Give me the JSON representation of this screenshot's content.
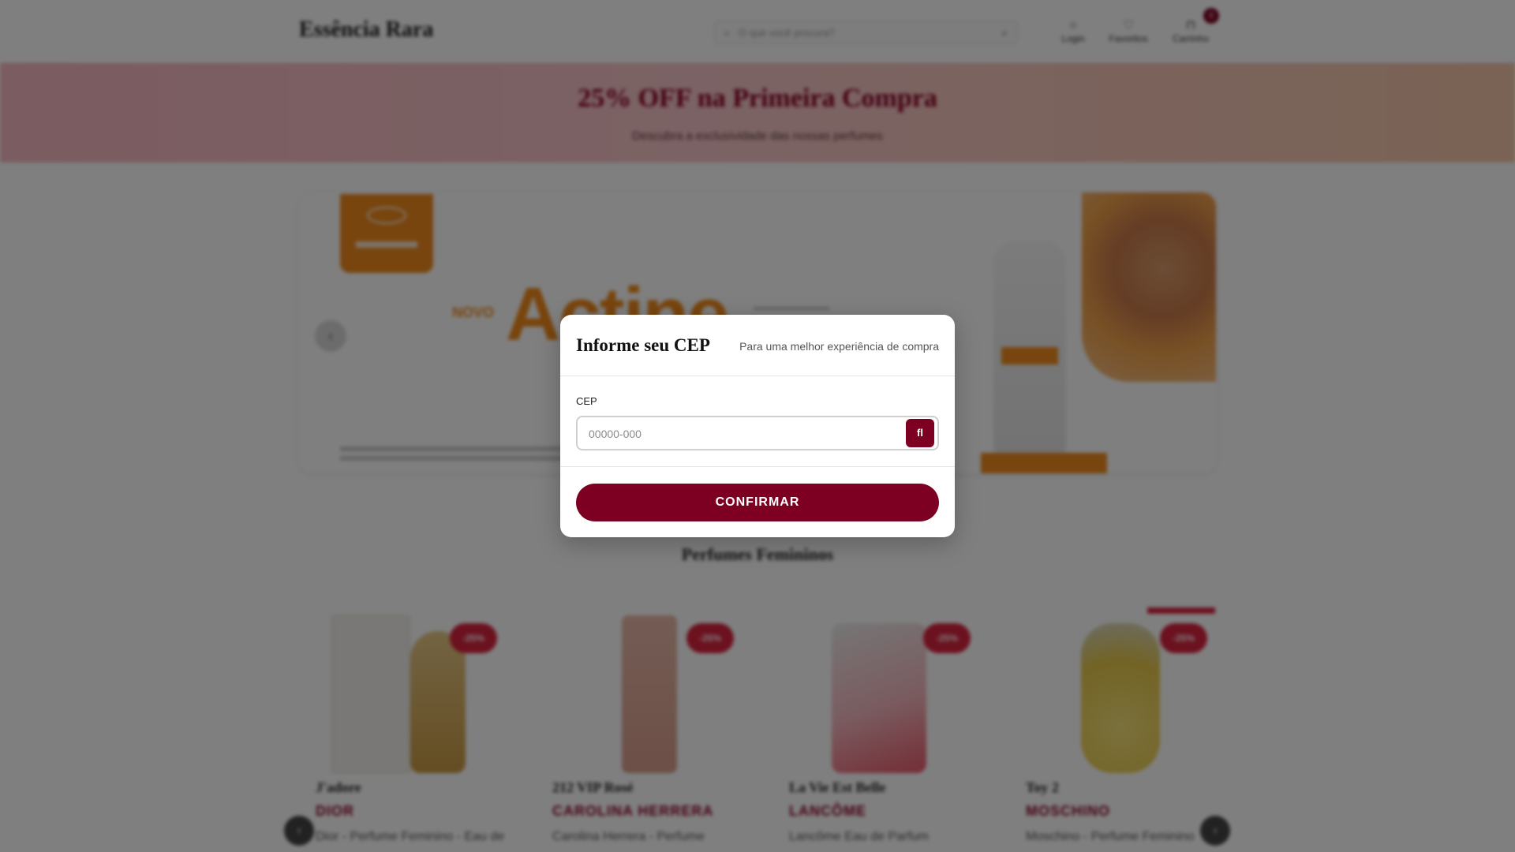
{
  "header": {
    "logo": "Essência Rara",
    "search_placeholder": "O que você procura?",
    "account_label": "Login",
    "favorites_label": "Favoritos",
    "cart_label": "Carrinho",
    "cart_count": "0",
    "icons": {
      "search": "search-icon",
      "account": "user-icon",
      "favorites": "heart-icon",
      "cart": "bag-icon"
    }
  },
  "promo": {
    "title": "25% OFF na Primeira Compra",
    "subtitle": "Descubra a exclusividade das nossas perfumes"
  },
  "hero": {
    "novo": "NOVO",
    "headline": "Actine"
  },
  "section": {
    "title": "Perfumes Femininos"
  },
  "products": [
    {
      "name": "J'adore",
      "brand": "DIOR",
      "desc": "Dior - Perfume Feminino - Eau de",
      "badge": "-25%"
    },
    {
      "name": "212 VIP Rosé",
      "brand": "CAROLINA HERRERA",
      "desc": "Carolina Herrera - Perfume",
      "badge": "-25%"
    },
    {
      "name": "La Vie Est Belle",
      "brand": "LANCÔME",
      "desc": "Lancôme Eau de Parfum",
      "badge": "-25%"
    },
    {
      "name": "Toy 2",
      "brand": "MOSCHINO",
      "desc": "Moschino - Perfume Feminino",
      "badge": "-25%"
    }
  ],
  "modal": {
    "title": "Informe seu CEP",
    "subtitle": "Para uma melhor experiência de compra",
    "cep_label": "CEP",
    "cep_placeholder": "00000-000",
    "cep_value": "",
    "search_button_glyph": "fl",
    "confirm_label": "CONFIRMAR"
  },
  "colors": {
    "brand": "#7d0022",
    "overlay": "rgba(0,0,0,0.5)",
    "promo_title": "#8a0024"
  }
}
